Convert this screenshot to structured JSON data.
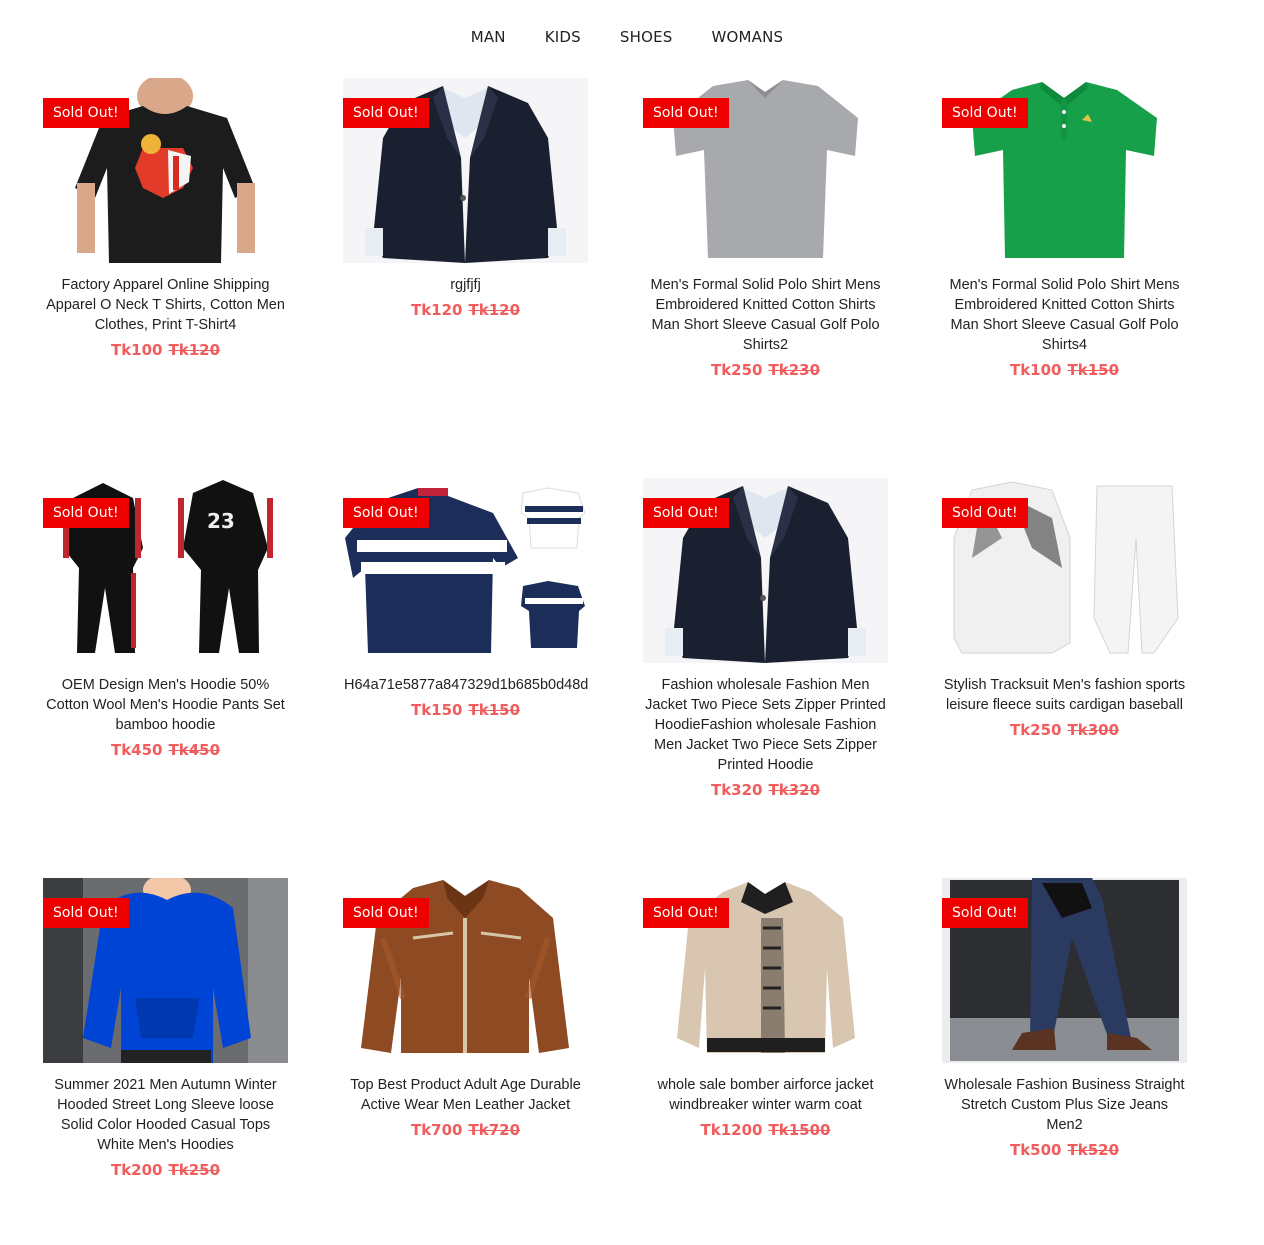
{
  "nav": [
    "MAN",
    "KIDS",
    "SHOES",
    "WOMANS"
  ],
  "currency": "Tk",
  "products": [
    {
      "title": "Factory Apparel Online Shipping Apparel O Neck T Shirts, Cotton Men Clothes, Print T-Shirt4",
      "price": "Tk100",
      "old_price": "Tk120",
      "badge": "Sold Out!",
      "image": "black-tshirt"
    },
    {
      "title": "rgjfjfj",
      "price": "Tk120",
      "old_price": "Tk120",
      "badge": "Sold Out!",
      "image": "navy-blazer"
    },
    {
      "title": "Men's Formal Solid Polo Shirt Mens Embroidered Knitted Cotton Shirts Man Short Sleeve Casual Golf Polo Shirts2",
      "price": "Tk250",
      "old_price": "Tk230",
      "badge": "Sold Out!",
      "image": "grey-polo"
    },
    {
      "title": "Men's Formal Solid Polo Shirt Mens Embroidered Knitted Cotton Shirts Man Short Sleeve Casual Golf Polo Shirts4",
      "price": "Tk100",
      "old_price": "Tk150",
      "badge": "Sold Out!",
      "image": "green-polo"
    },
    {
      "title": "OEM Design Men's Hoodie 50% Cotton Wool Men's Hoodie Pants Set bamboo hoodie",
      "price": "Tk450",
      "old_price": "Tk450",
      "badge": "Sold Out!",
      "image": "black-tracksuit"
    },
    {
      "title": "H64a71e5877a847329d1b685b0d48dl",
      "price": "Tk150",
      "old_price": "Tk150",
      "badge": "Sold Out!",
      "image": "striped-polo"
    },
    {
      "title": "Fashion wholesale Fashion Men Jacket Two Piece Sets Zipper Printed HoodieFashion wholesale Fashion Men Jacket Two Piece Sets Zipper Printed Hoodie",
      "price": "Tk320",
      "old_price": "Tk320",
      "badge": "Sold Out!",
      "image": "navy-blazer"
    },
    {
      "title": "Stylish Tracksuit Men's fashion sports leisure fleece suits cardigan baseball",
      "price": "Tk250",
      "old_price": "Tk300",
      "badge": "Sold Out!",
      "image": "white-tracksuit"
    },
    {
      "title": "Summer 2021 Men Autumn Winter Hooded Street Long Sleeve loose Solid Color Hooded Casual Tops White Men's Hoodies",
      "price": "Tk200",
      "old_price": "Tk250",
      "badge": "Sold Out!",
      "image": "blue-hoodie"
    },
    {
      "title": "Top Best Product Adult Age Durable Active Wear Men Leather Jacket",
      "price": "Tk700",
      "old_price": "Tk720",
      "badge": "Sold Out!",
      "image": "leather-jacket"
    },
    {
      "title": "whole sale bomber airforce jacket windbreaker winter warm coat",
      "price": "Tk1200",
      "old_price": "Tk1500",
      "badge": "Sold Out!",
      "image": "beige-bomber"
    },
    {
      "title": "Wholesale Fashion Business Straight Stretch Custom Plus Size Jeans Men2",
      "price": "Tk500",
      "old_price": "Tk520",
      "badge": "Sold Out!",
      "image": "denim-jeans"
    }
  ]
}
